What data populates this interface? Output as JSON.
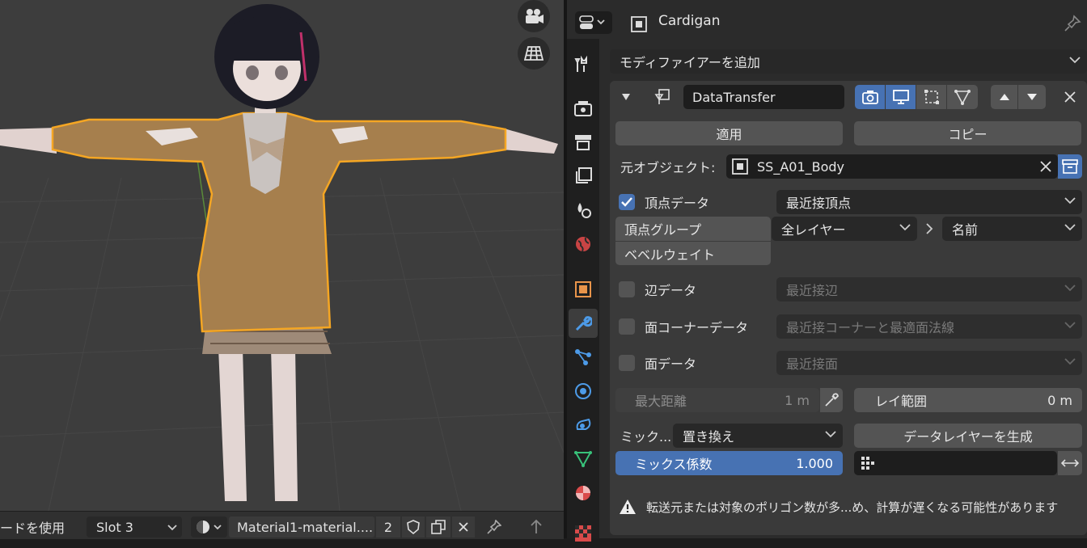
{
  "viewport": {
    "bottom_bar": {
      "mode_label": "ードを使用",
      "slot_label": "Slot 3",
      "material_name": "Material1-material....",
      "user_count": "2"
    }
  },
  "properties": {
    "object_name": "Cardigan",
    "add_modifier_label": "モディファイアーを追加",
    "modifier": {
      "name": "DataTransfer",
      "apply_label": "適用",
      "copy_label": "コピー",
      "source_object_label": "元オブジェクト:",
      "source_object_value": "SS_A01_Body",
      "vertex_data_label": "頂点データ",
      "vertex_data_mapping": "最近接頂点",
      "vertex_groups_label": "頂点グループ",
      "bevel_weight_label": "ベベルウェイト",
      "layers_select_src": "全レイヤー",
      "layers_select_dst": "名前",
      "edge_data_label": "辺データ",
      "edge_data_mapping": "最近接辺",
      "face_corner_data_label": "面コーナーデータ",
      "face_corner_data_mapping": "最近接コーナーと最適面法線",
      "face_data_label": "面データ",
      "face_data_mapping": "最近接面",
      "max_distance_label": "最大距離",
      "max_distance_value": "1 m",
      "ray_radius_label": "レイ範囲",
      "ray_radius_value": "0 m",
      "mix_mode_label": "ミック...",
      "mix_mode_value": "置き換え",
      "generate_layers_label": "データレイヤーを生成",
      "mix_factor_label": "ミックス係数",
      "mix_factor_value": "1.000",
      "warning_text": "転送元または対象のポリゴン数が多...め、計算が遅くなる可能性があります"
    }
  },
  "colors": {
    "accent": "#4772b3",
    "selection_outline": "#f5a623",
    "viewport_bg": "#3d3d3d",
    "panel_bg": "#2b2b2b"
  }
}
